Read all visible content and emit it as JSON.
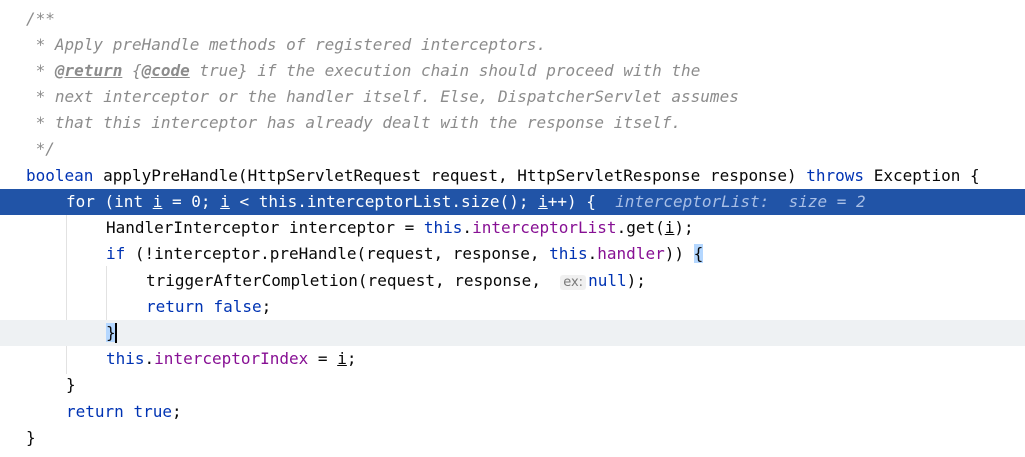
{
  "editor": {
    "lines": [
      {
        "id": "l1",
        "parts": [
          {
            "t": "/**",
            "c": "cmt"
          }
        ]
      },
      {
        "id": "l2",
        "parts": [
          {
            "t": " * Apply preHandle methods of registered interceptors.",
            "c": "cmt"
          }
        ]
      },
      {
        "id": "l3",
        "parts": [
          {
            "t": " * ",
            "c": "cmt"
          },
          {
            "t": "@return",
            "c": "tag"
          },
          {
            "t": " {",
            "c": "cmt"
          },
          {
            "t": "@code",
            "c": "tag"
          },
          {
            "t": " true} if the execution chain should proceed with the",
            "c": "cmt"
          }
        ]
      },
      {
        "id": "l4",
        "parts": [
          {
            "t": " * next interceptor or the handler itself. Else, DispatcherServlet assumes",
            "c": "cmt"
          }
        ]
      },
      {
        "id": "l5",
        "parts": [
          {
            "t": " * that this interceptor has already dealt with the response itself.",
            "c": "cmt"
          }
        ]
      },
      {
        "id": "l6",
        "parts": [
          {
            "t": " */",
            "c": "cmt"
          }
        ]
      },
      {
        "id": "l7",
        "parts": [
          {
            "t": "boolean",
            "c": "kw"
          },
          {
            "t": " applyPreHandle(HttpServletRequest request, HttpServletResponse response) "
          },
          {
            "t": "throws",
            "c": "kw"
          },
          {
            "t": " Exception {"
          }
        ]
      },
      {
        "id": "l8",
        "parts": [
          {
            "t": "for",
            "c": "kw"
          },
          {
            "t": " ("
          },
          {
            "t": "int",
            "c": "kw"
          },
          {
            "t": " "
          },
          {
            "t": "i",
            "c": "ul"
          },
          {
            "t": " = "
          },
          {
            "t": "0",
            "c": "kw"
          },
          {
            "t": "; "
          },
          {
            "t": "i",
            "c": "ul"
          },
          {
            "t": " < "
          },
          {
            "t": "this",
            "c": "kw"
          },
          {
            "t": "."
          },
          {
            "t": "interceptorList",
            "c": "fld"
          },
          {
            "t": ".size(); "
          },
          {
            "t": "i",
            "c": "ul"
          },
          {
            "t": "++) {  "
          },
          {
            "t": "interceptorList:  size = 2",
            "c": "inline-val"
          }
        ]
      },
      {
        "id": "l9",
        "parts": [
          {
            "t": "HandlerInterceptor interceptor = "
          },
          {
            "t": "this",
            "c": "kw"
          },
          {
            "t": "."
          },
          {
            "t": "interceptorList",
            "c": "fld"
          },
          {
            "t": ".get("
          },
          {
            "t": "i",
            "c": "ul"
          },
          {
            "t": ");"
          }
        ]
      },
      {
        "id": "l10",
        "parts": [
          {
            "t": "if",
            "c": "kw"
          },
          {
            "t": " (!interceptor.preHandle(request, response, "
          },
          {
            "t": "this",
            "c": "kw"
          },
          {
            "t": "."
          },
          {
            "t": "handler",
            "c": "fld"
          },
          {
            "t": ")) "
          },
          {
            "t": "{",
            "c": "brace-match"
          }
        ]
      },
      {
        "id": "l11",
        "parts": [
          {
            "t": "triggerAfterCompletion(request, response,  "
          },
          {
            "t": "ex:",
            "c": "hint"
          },
          {
            "t": "null",
            "c": "kw"
          },
          {
            "t": ");"
          }
        ]
      },
      {
        "id": "l12",
        "parts": [
          {
            "t": "return",
            "c": "kw"
          },
          {
            "t": " "
          },
          {
            "t": "false",
            "c": "kw"
          },
          {
            "t": ";"
          }
        ]
      },
      {
        "id": "l13",
        "parts": [
          {
            "t": "}",
            "c": "brace-match"
          }
        ]
      },
      {
        "id": "l14",
        "parts": [
          {
            "t": "this",
            "c": "kw"
          },
          {
            "t": "."
          },
          {
            "t": "interceptorIndex",
            "c": "fld"
          },
          {
            "t": " = "
          },
          {
            "t": "i",
            "c": "ul"
          },
          {
            "t": ";"
          }
        ]
      },
      {
        "id": "l15",
        "parts": [
          {
            "t": "}"
          }
        ]
      },
      {
        "id": "l16",
        "parts": [
          {
            "t": "return",
            "c": "kw"
          },
          {
            "t": " "
          },
          {
            "t": "true",
            "c": "kw"
          },
          {
            "t": ";"
          }
        ]
      },
      {
        "id": "l17",
        "parts": [
          {
            "t": "}"
          }
        ]
      }
    ]
  }
}
